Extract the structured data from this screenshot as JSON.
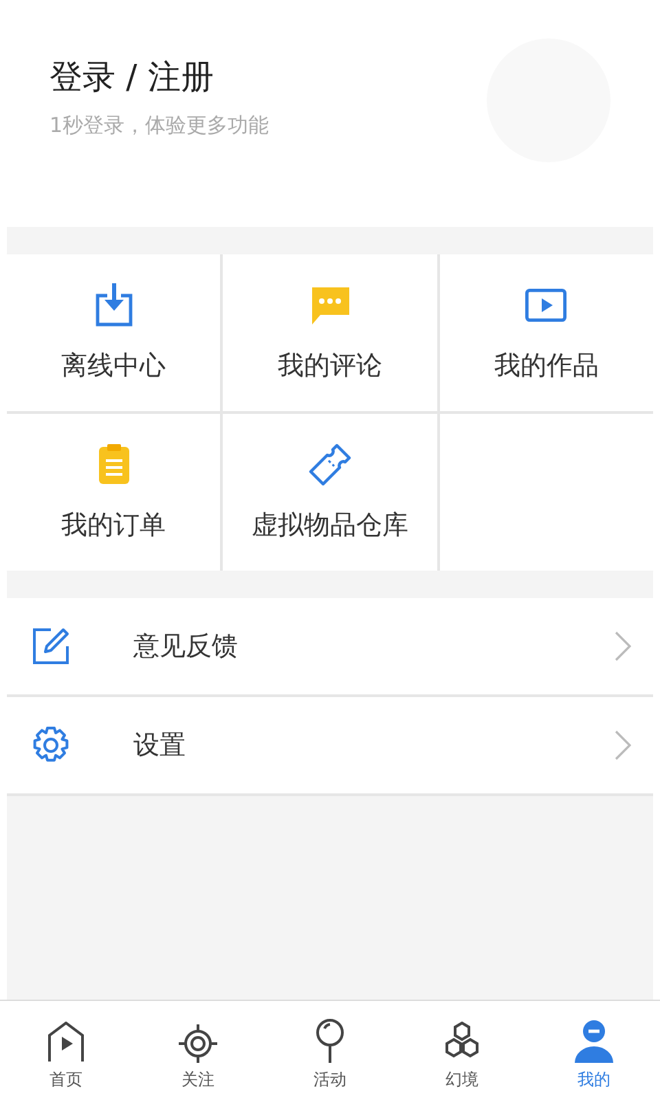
{
  "profile": {
    "title": "登录 / 注册",
    "subtitle": "1秒登录，体验更多功能"
  },
  "shortcuts": [
    {
      "label": "离线中心"
    },
    {
      "label": "我的评论"
    },
    {
      "label": "我的作品"
    },
    {
      "label": "我的订单"
    },
    {
      "label": "虚拟物品仓库"
    }
  ],
  "menu": [
    {
      "label": "意见反馈"
    },
    {
      "label": "设置"
    }
  ],
  "tabs": [
    {
      "label": "首页",
      "selected": false
    },
    {
      "label": "关注",
      "selected": false
    },
    {
      "label": "活动",
      "selected": false
    },
    {
      "label": "幻境",
      "selected": false
    },
    {
      "label": "我的",
      "selected": true
    }
  ]
}
